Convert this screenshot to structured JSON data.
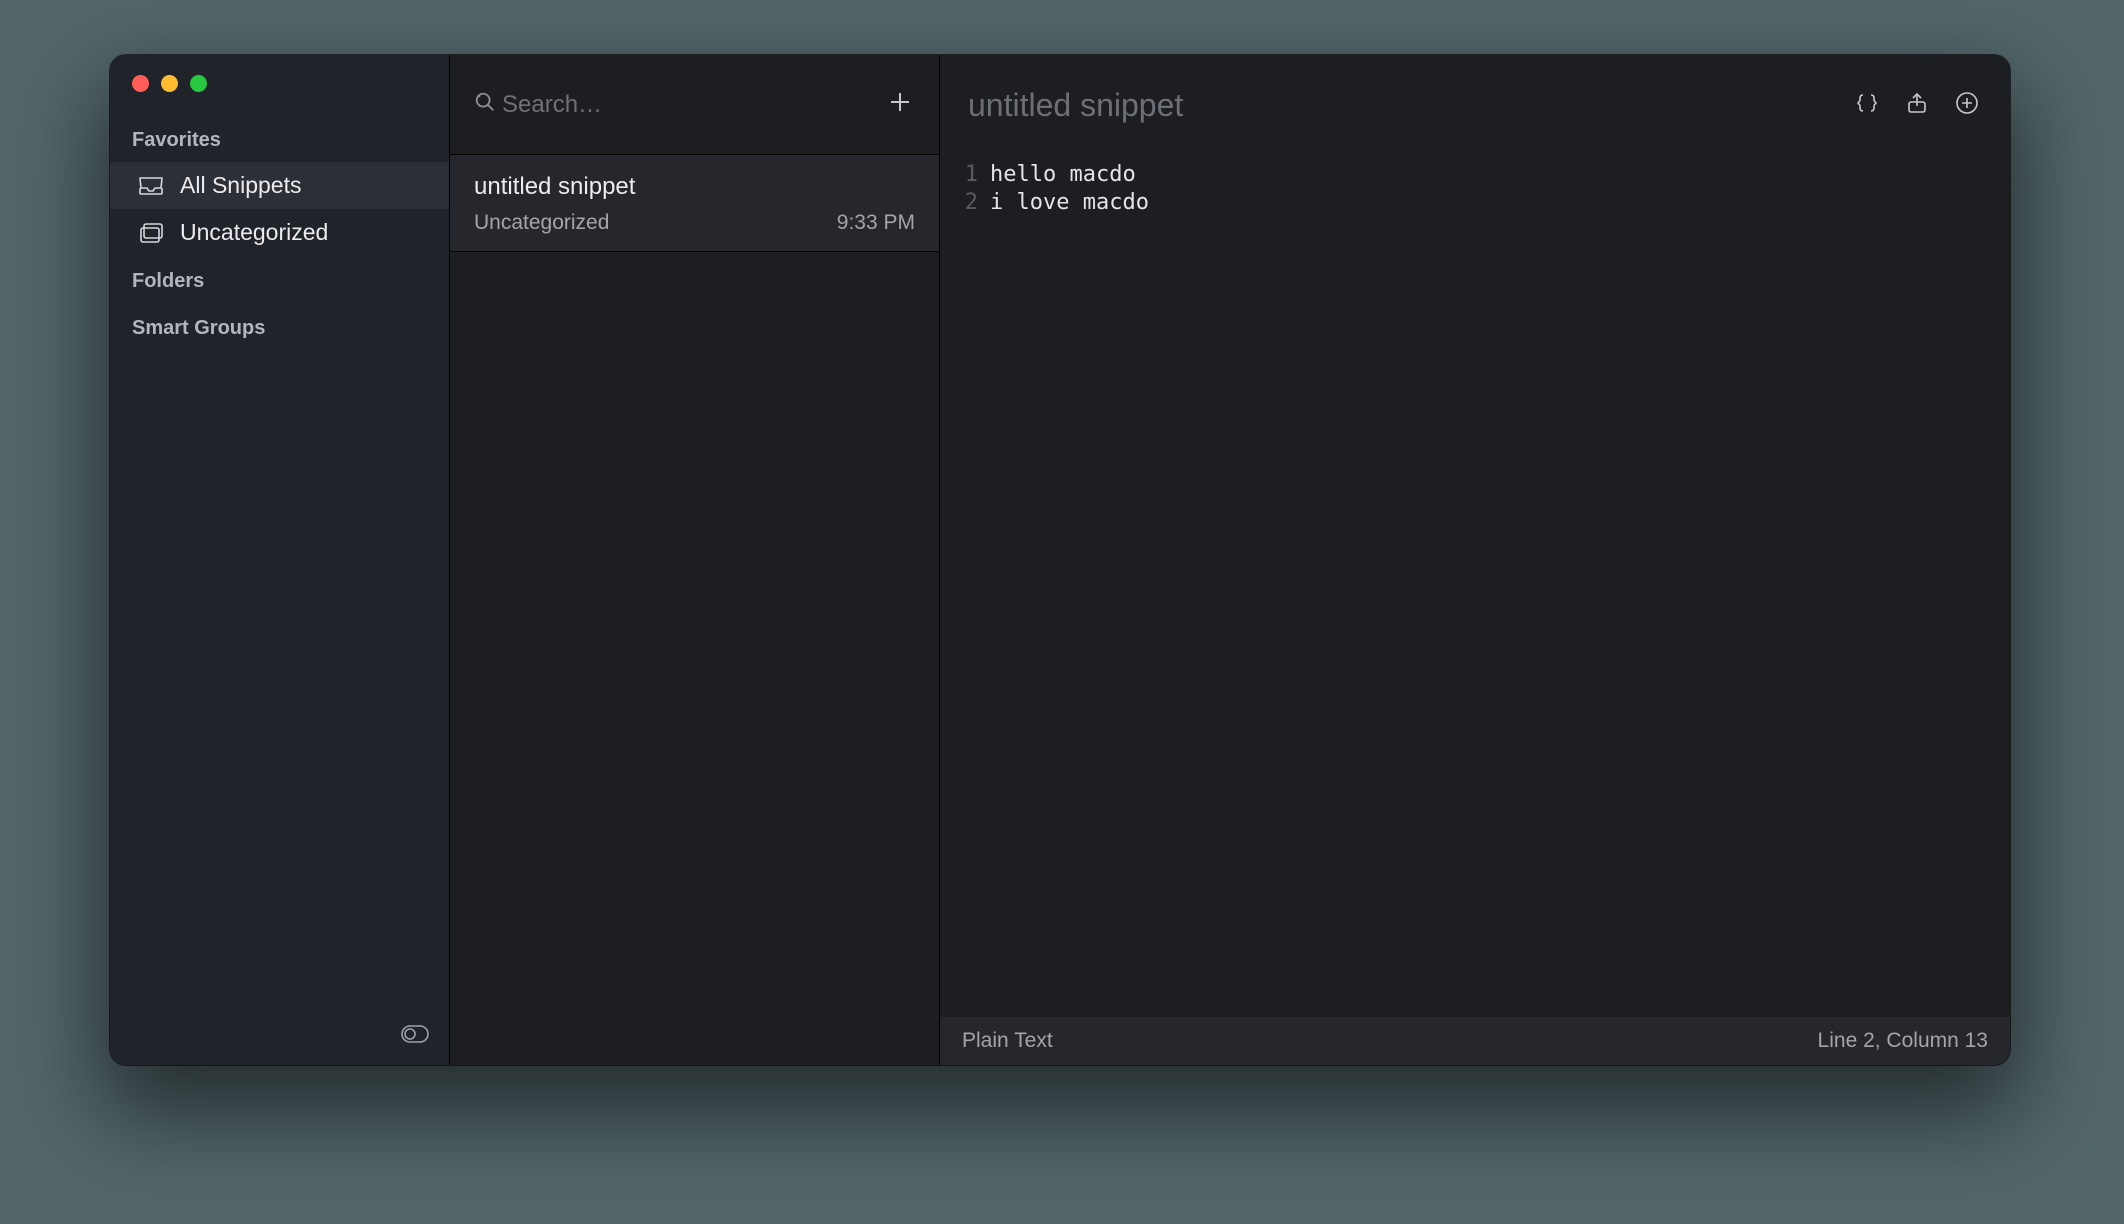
{
  "sidebar": {
    "sections": {
      "favorites_label": "Favorites",
      "folders_label": "Folders",
      "smart_groups_label": "Smart Groups"
    },
    "items": [
      {
        "label": "All Snippets"
      },
      {
        "label": "Uncategorized"
      }
    ]
  },
  "list": {
    "search_placeholder": "Search…",
    "snippets": [
      {
        "title": "untitled snippet",
        "category": "Uncategorized",
        "time": "9:33 PM"
      }
    ]
  },
  "editor": {
    "title": "untitled snippet",
    "lines": [
      "hello macdo",
      "i love macdo"
    ]
  },
  "statusbar": {
    "language": "Plain Text",
    "position": "Line 2, Column 13"
  }
}
